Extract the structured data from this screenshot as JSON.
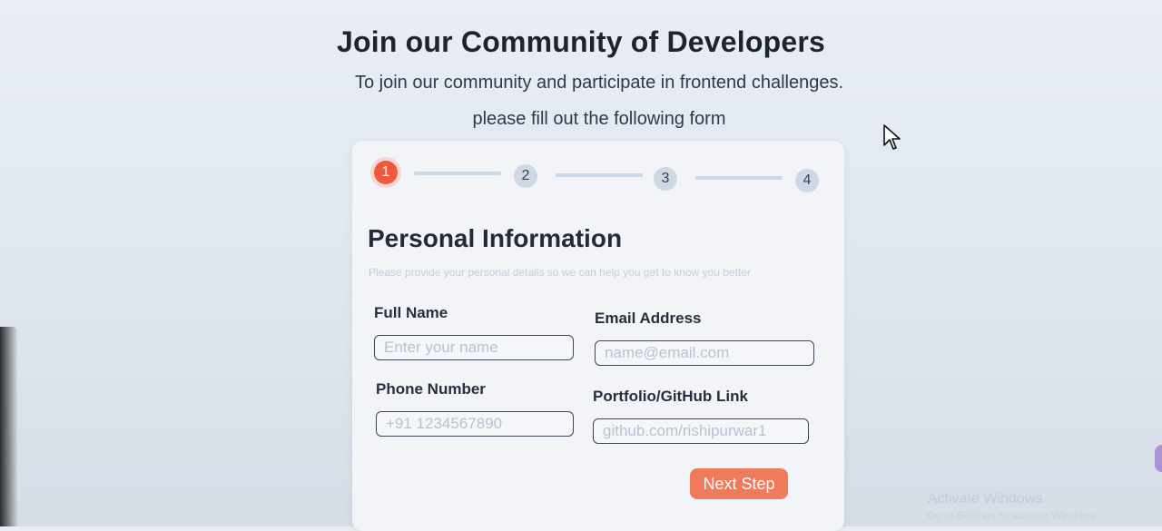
{
  "header": {
    "title": "Join our Community of Developers",
    "subtitle_line1": "To join our community and participate in frontend challenges.",
    "subtitle_line2": "please fill out the following form"
  },
  "stepper": {
    "steps": [
      "1",
      "2",
      "3",
      "4"
    ],
    "active_step": 1
  },
  "section": {
    "title": "Personal Information",
    "description": "Please provide your personal details so we can help you get to know you better"
  },
  "fields": {
    "full_name": {
      "label": "Full Name",
      "placeholder": "Enter your name"
    },
    "email": {
      "label": "Email Address",
      "placeholder": "name@email.com"
    },
    "phone": {
      "label": "Phone Number",
      "placeholder": "+91 1234567890"
    },
    "portfolio": {
      "label": "Portfolio/GitHub Link",
      "placeholder": "github.com/rishipurwar1"
    }
  },
  "actions": {
    "next_step": "Next Step"
  },
  "overlay": {
    "windows_title": "Activate Windows",
    "windows_sub": "Go to Settings to activate Windows."
  },
  "colors": {
    "accent": "#ef5a3c",
    "button": "#f07a5c",
    "background": "#e6ecf3",
    "card": "#f2f4f7",
    "step_inactive": "#cfd9e6"
  },
  "icons": {
    "cursor": "cursor-icon"
  }
}
